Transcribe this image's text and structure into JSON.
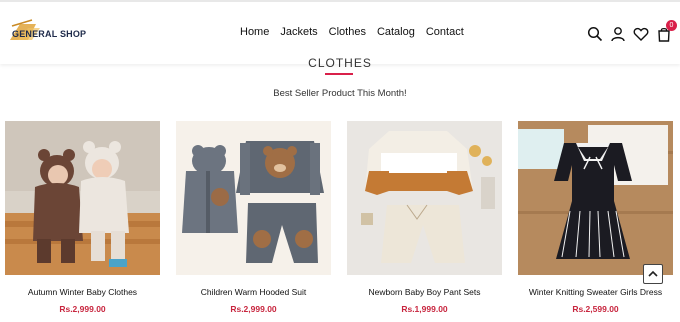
{
  "brand": {
    "name_part1": "GENERAL",
    "name_part2": "SHOP"
  },
  "nav": {
    "items": [
      "Home",
      "Jackets",
      "Clothes",
      "Catalog",
      "Contact"
    ]
  },
  "header_icons": [
    "search-icon",
    "user-icon",
    "heart-icon",
    "bag-icon"
  ],
  "cart": {
    "count": "0"
  },
  "section": {
    "title": "CLOTHES",
    "subtitle": "Best Seller Product This Month!"
  },
  "products": [
    {
      "name": "Autumn Winter Baby Clothes",
      "price": "Rs.2,999.00"
    },
    {
      "name": "Children Warm Hooded Suit",
      "price": "Rs.2,999.00"
    },
    {
      "name": "Newborn Baby Boy Pant Sets",
      "price": "Rs.1,999.00"
    },
    {
      "name": "Winter Knitting Sweater Girls Dress",
      "price": "Rs.2,599.00"
    }
  ],
  "colors": {
    "accent": "#d9204a",
    "price": "#c8263f",
    "logo_gold": "#e0a43a",
    "logo_navy": "#1e2a4a"
  }
}
